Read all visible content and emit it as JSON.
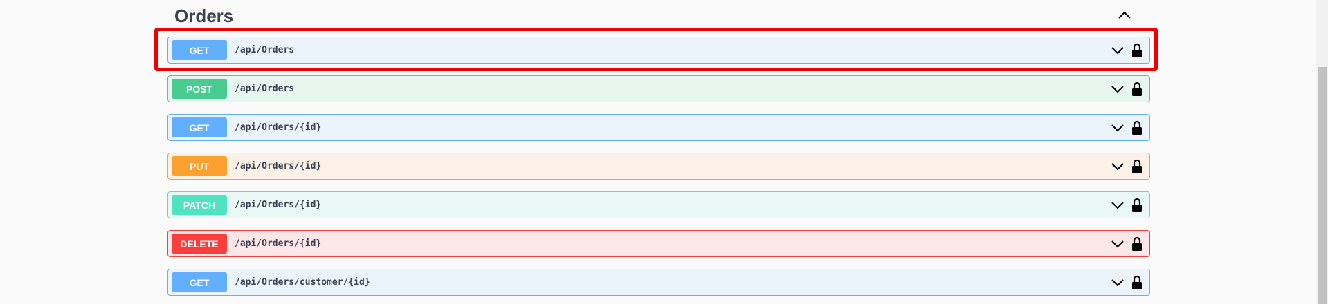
{
  "section": {
    "title": "Orders",
    "toggle_icon": "chevron-up-icon"
  },
  "operations": [
    {
      "method": "GET",
      "path": "/api/Orders"
    },
    {
      "method": "POST",
      "path": "/api/Orders"
    },
    {
      "method": "GET",
      "path": "/api/Orders/{id}"
    },
    {
      "method": "PUT",
      "path": "/api/Orders/{id}"
    },
    {
      "method": "PATCH",
      "path": "/api/Orders/{id}"
    },
    {
      "method": "DELETE",
      "path": "/api/Orders/{id}"
    },
    {
      "method": "GET",
      "path": "/api/Orders/customer/{id}"
    }
  ],
  "colors": {
    "get": "#61affe",
    "post": "#49cc90",
    "put": "#fca130",
    "patch": "#50e3c2",
    "delete": "#f93e3e",
    "highlight": "#ee0000"
  }
}
